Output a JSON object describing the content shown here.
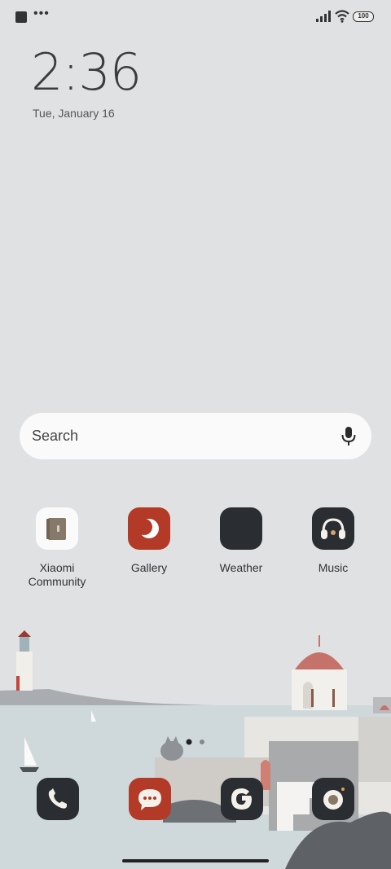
{
  "status": {
    "notification_dots": "•••",
    "battery": "100"
  },
  "clock": {
    "time": "2:36",
    "date": "Tue, January 16"
  },
  "search": {
    "placeholder": "Search"
  },
  "apps": [
    {
      "label": "Xiaomi Community",
      "icon": "book-icon"
    },
    {
      "label": "Gallery",
      "icon": "gallery-icon"
    },
    {
      "label": "Weather",
      "icon": "weather-icon"
    },
    {
      "label": "Music",
      "icon": "headphones-icon"
    }
  ],
  "dock": [
    {
      "name": "phone",
      "icon": "phone-icon"
    },
    {
      "name": "messages",
      "icon": "chat-icon"
    },
    {
      "name": "google",
      "icon": "google-icon"
    },
    {
      "name": "camera",
      "icon": "camera-icon"
    }
  ],
  "colors": {
    "background": "#e0e1e3",
    "dark_icon": "#2a2e33",
    "red_icon": "#b23a26"
  }
}
